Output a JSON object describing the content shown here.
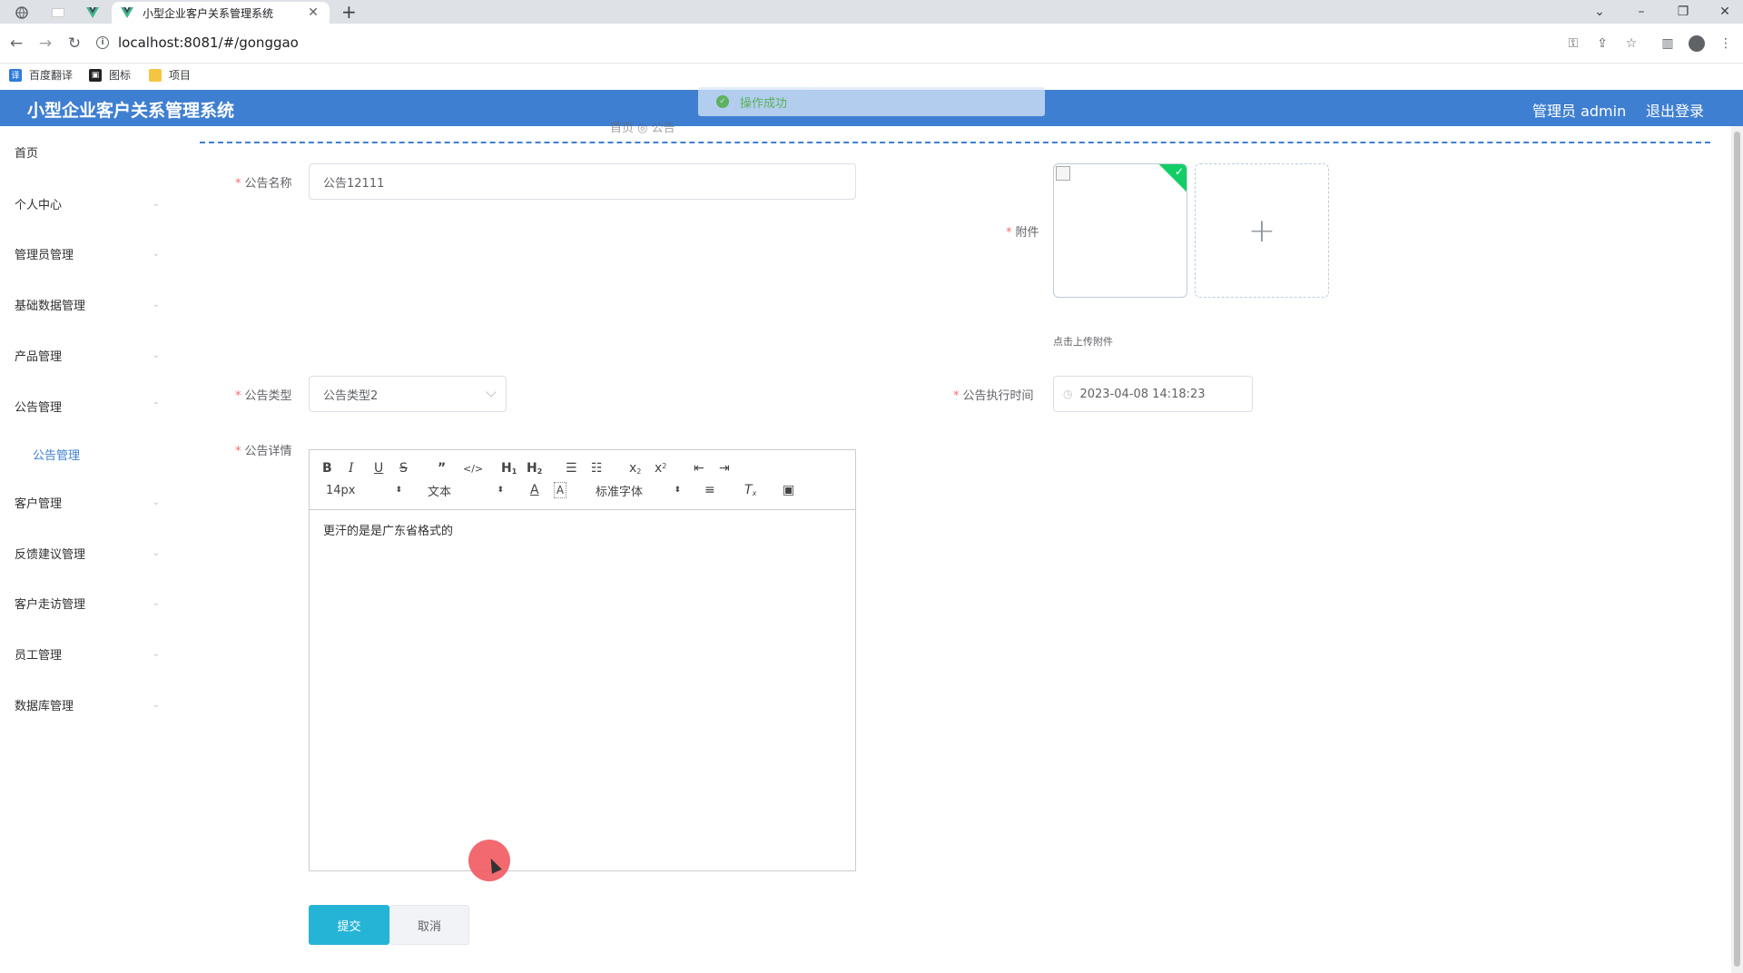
{
  "browser": {
    "tab_title": "小型企业客户关系管理系统",
    "url": "localhost:8081/#/gonggao",
    "bookmarks": [
      "百度翻译",
      "图标",
      "项目"
    ]
  },
  "header": {
    "title": "小型企业客户关系管理系统",
    "user": "管理员 admin",
    "logout": "退出登录",
    "toast": "操作成功",
    "accent_color": "#3f7fd1"
  },
  "breadcrumb": {
    "text": "首页 ◎ 公告"
  },
  "sidebar": {
    "items": [
      {
        "label": "首页"
      },
      {
        "label": "个人中心"
      },
      {
        "label": "管理员管理"
      },
      {
        "label": "基础数据管理"
      },
      {
        "label": "产品管理"
      },
      {
        "label": "公告管理"
      },
      {
        "label": "客户管理"
      },
      {
        "label": "反馈建议管理"
      },
      {
        "label": "客户走访管理"
      },
      {
        "label": "员工管理"
      },
      {
        "label": "数据库管理"
      }
    ],
    "sub_active": "公告管理"
  },
  "form": {
    "name_label": "公告名称",
    "name_value": "公告12111",
    "attachment_label": "附件",
    "attachment_tip": "点击上传附件",
    "type_label": "公告类型",
    "type_value": "公告类型2",
    "time_label": "公告执行时间",
    "time_value": "2023-04-08 14:18:23",
    "detail_label": "公告详情",
    "detail_content": "更汗的是是广东省格式的",
    "submit": "提交",
    "cancel": "取消"
  },
  "editor_toolbar": {
    "size": "14px",
    "header": "文本",
    "font": "标准字体"
  }
}
